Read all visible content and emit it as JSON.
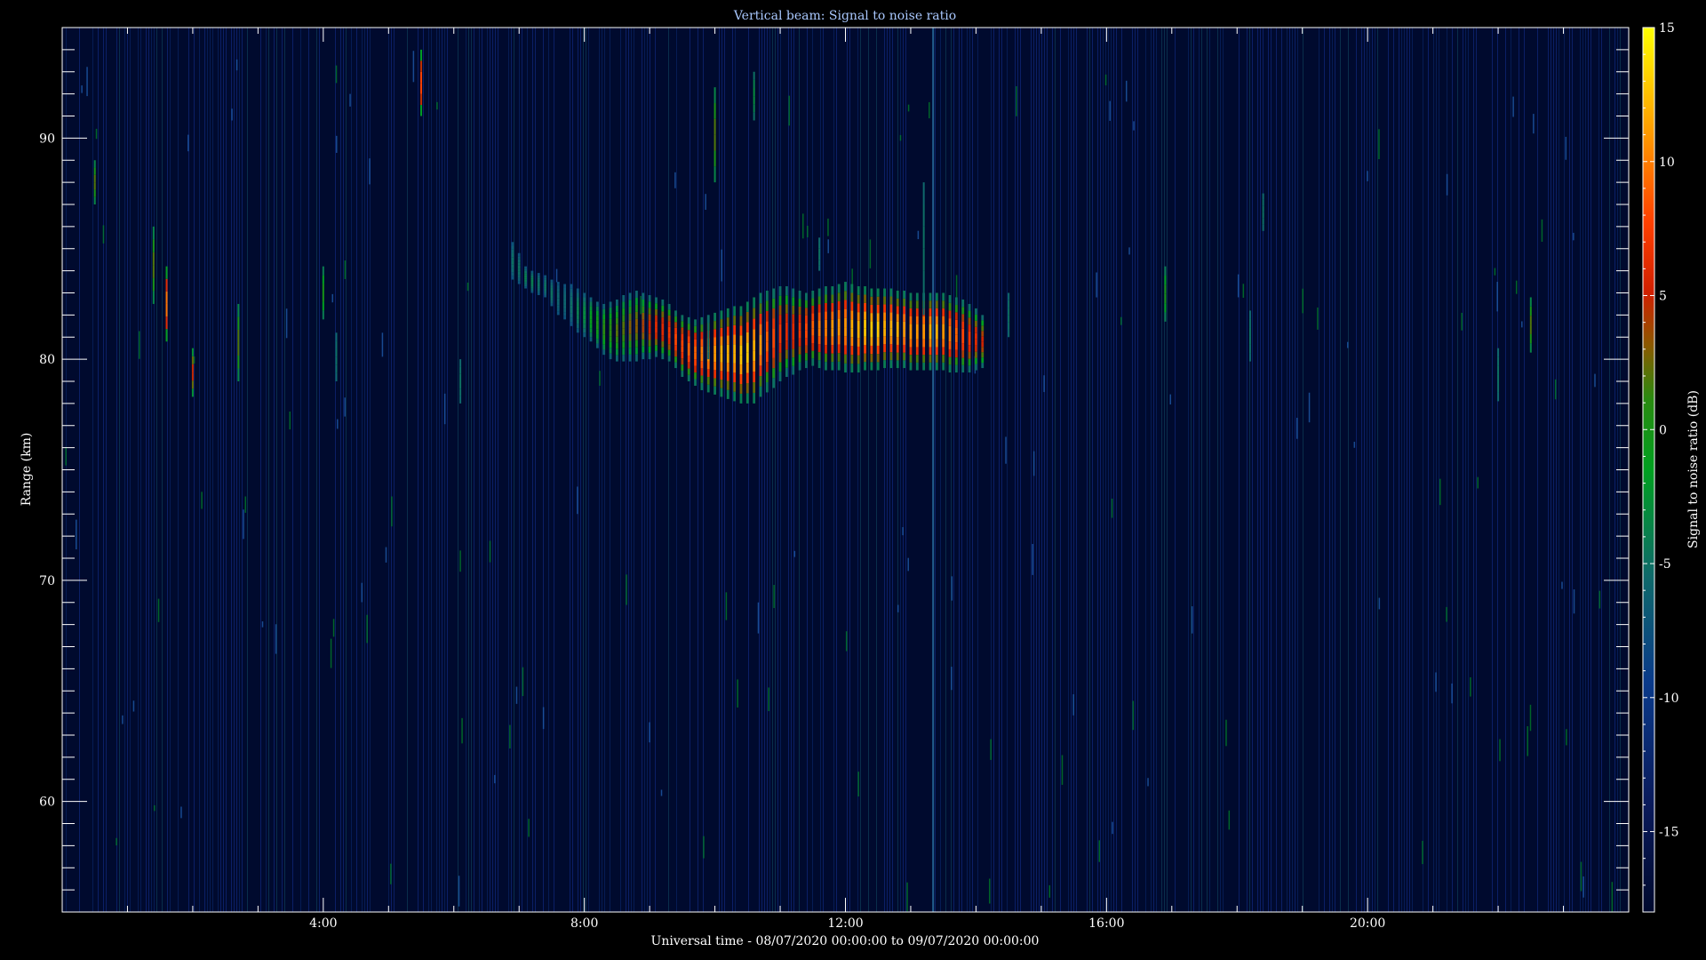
{
  "chart_data": {
    "type": "heatmap",
    "title": "Vertical beam: Signal to noise ratio",
    "xlabel": "Universal time - 08/07/2020 00:00:00 to 09/07/2020 00:00:00",
    "ylabel": "Range (km)",
    "colorbar_label": "Signal to noise ratio (dB)",
    "x_unit": "hours UT",
    "xlim": [
      0,
      24
    ],
    "ylim": [
      55,
      95
    ],
    "x_ticks": [
      {
        "value": 4,
        "label": "4:00"
      },
      {
        "value": 8,
        "label": "8:00"
      },
      {
        "value": 12,
        "label": "12:00"
      },
      {
        "value": 16,
        "label": "16:00"
      },
      {
        "value": 20,
        "label": "20:00"
      }
    ],
    "y_ticks": [
      {
        "value": 60,
        "label": "60"
      },
      {
        "value": 70,
        "label": "70"
      },
      {
        "value": 80,
        "label": "80"
      },
      {
        "value": 90,
        "label": "90"
      }
    ],
    "colorbar_range": [
      -18,
      15
    ],
    "colorbar_ticks": [
      {
        "value": 15,
        "label": "15"
      },
      {
        "value": 10,
        "label": "10"
      },
      {
        "value": 5,
        "label": "5"
      },
      {
        "value": 0,
        "label": "0"
      },
      {
        "value": -5,
        "label": "-5"
      },
      {
        "value": -10,
        "label": "-10"
      },
      {
        "value": -15,
        "label": "-15"
      }
    ],
    "colormap": [
      "#000a2e",
      "#0a2a7a",
      "#0f6a6a",
      "#00a020",
      "#3ca800",
      "#c83000",
      "#ff3000",
      "#ff9a00",
      "#ffff00"
    ],
    "echo_layer": {
      "time_range": [
        6.9,
        14.1
      ],
      "time_step_hours": 0.1,
      "top_km": [
        85.3,
        84.8,
        84.2,
        84.0,
        83.9,
        83.8,
        83.6,
        83.5,
        83.4,
        83.4,
        83.2,
        83.0,
        82.8,
        82.6,
        82.5,
        82.6,
        82.7,
        82.9,
        83.0,
        83.1,
        83.0,
        82.9,
        82.8,
        82.7,
        82.5,
        82.2,
        82.0,
        81.9,
        81.8,
        81.9,
        82.0,
        82.1,
        82.2,
        82.3,
        82.4,
        82.4,
        82.6,
        82.8,
        83.0,
        83.1,
        83.2,
        83.3,
        83.3,
        83.2,
        83.1,
        83.0,
        83.1,
        83.2,
        83.3,
        83.3,
        83.4,
        83.5,
        83.4,
        83.3,
        83.3,
        83.2,
        83.2,
        83.2,
        83.2,
        83.1,
        83.1,
        83.0,
        83.0,
        83.0,
        83.0,
        83.0,
        83.0,
        82.9,
        82.8,
        82.7,
        82.5,
        82.3,
        82.0
      ],
      "bottom_km": [
        83.6,
        83.4,
        83.2,
        83.0,
        82.9,
        82.8,
        82.4,
        82.0,
        81.8,
        81.5,
        81.2,
        81.0,
        80.8,
        80.5,
        80.2,
        80.0,
        79.9,
        79.9,
        79.9,
        79.9,
        80.0,
        80.0,
        80.1,
        80.0,
        79.9,
        79.6,
        79.2,
        79.0,
        78.8,
        78.6,
        78.5,
        78.4,
        78.3,
        78.2,
        78.1,
        78.0,
        78.0,
        78.0,
        78.3,
        78.5,
        78.7,
        79.0,
        79.2,
        79.3,
        79.5,
        79.6,
        79.7,
        79.6,
        79.5,
        79.5,
        79.5,
        79.4,
        79.4,
        79.4,
        79.5,
        79.5,
        79.5,
        79.6,
        79.6,
        79.6,
        79.6,
        79.5,
        79.5,
        79.5,
        79.5,
        79.5,
        79.5,
        79.4,
        79.4,
        79.4,
        79.4,
        79.5,
        79.6
      ],
      "peak_snr_db": [
        -5,
        -5,
        -4,
        -4,
        -5,
        -5,
        -5,
        -6,
        -6,
        -5,
        -4,
        -3,
        -1,
        0,
        1,
        1,
        2,
        2,
        3,
        3,
        4,
        5,
        6,
        6,
        7,
        8,
        8,
        9,
        9,
        10,
        11,
        11,
        12,
        12,
        12,
        13,
        13,
        12,
        11,
        9,
        8,
        7,
        6,
        6,
        7,
        8,
        9,
        10,
        10,
        11,
        11,
        11,
        12,
        12,
        13,
        13,
        13,
        12,
        12,
        12,
        11,
        11,
        11,
        11,
        12,
        12,
        11,
        10,
        9,
        8,
        7,
        6,
        5
      ]
    },
    "isolated_echoes": [
      {
        "t": 1.4,
        "r1": 82.5,
        "r2": 86.0,
        "snr": 2
      },
      {
        "t": 1.6,
        "r1": 80.8,
        "r2": 84.2,
        "snr": 10
      },
      {
        "t": 2.0,
        "r1": 78.3,
        "r2": 80.5,
        "snr": 5
      },
      {
        "t": 2.7,
        "r1": 79.0,
        "r2": 82.5,
        "snr": 2
      },
      {
        "t": 4.0,
        "r1": 81.8,
        "r2": 84.2,
        "snr": 0
      },
      {
        "t": 4.2,
        "r1": 79.0,
        "r2": 81.2,
        "snr": -5
      },
      {
        "t": 5.5,
        "r1": 91.0,
        "r2": 94.0,
        "snr": 8
      },
      {
        "t": 6.1,
        "r1": 78.0,
        "r2": 80.0,
        "snr": -5
      },
      {
        "t": 10.0,
        "r1": 88.0,
        "r2": 92.3,
        "snr": 2
      },
      {
        "t": 10.6,
        "r1": 90.8,
        "r2": 93.0,
        "snr": -3
      },
      {
        "t": 11.6,
        "r1": 84.0,
        "r2": 85.5,
        "snr": -5
      },
      {
        "t": 13.2,
        "r1": 82.0,
        "r2": 88.0,
        "snr": -5
      },
      {
        "t": 14.5,
        "r1": 81.0,
        "r2": 83.0,
        "snr": -5
      },
      {
        "t": 16.9,
        "r1": 81.7,
        "r2": 84.2,
        "snr": 0
      },
      {
        "t": 18.2,
        "r1": 79.9,
        "r2": 82.2,
        "snr": -5
      },
      {
        "t": 18.4,
        "r1": 85.8,
        "r2": 87.5,
        "snr": -5
      },
      {
        "t": 22.0,
        "r1": 78.1,
        "r2": 80.5,
        "snr": -5
      },
      {
        "t": 22.5,
        "r1": 80.3,
        "r2": 82.8,
        "snr": 2
      },
      {
        "t": 0.5,
        "r1": 87.0,
        "r2": 89.0,
        "snr": 2
      },
      {
        "t": 9.9,
        "r1": 80.0,
        "r2": 82.0,
        "snr": -5
      }
    ]
  }
}
